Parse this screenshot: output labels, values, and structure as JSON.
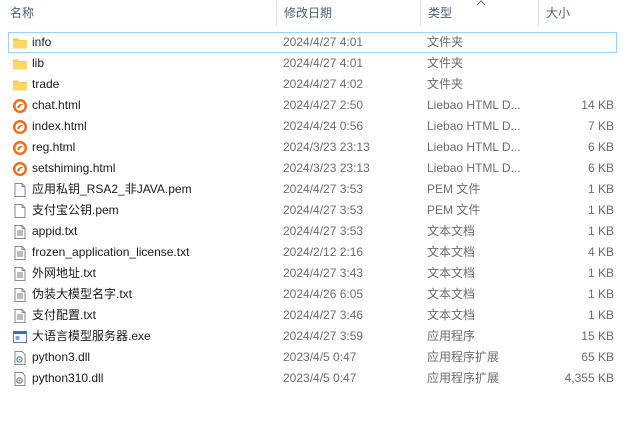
{
  "header": {
    "name": "名称",
    "date": "修改日期",
    "type": "类型",
    "size": "大小"
  },
  "files": [
    {
      "name": "info",
      "date": "2024/4/27 4:01",
      "type": "文件夹",
      "size": "",
      "icon": "folder-icon"
    },
    {
      "name": "lib",
      "date": "2024/4/27 4:01",
      "type": "文件夹",
      "size": "",
      "icon": "folder-icon"
    },
    {
      "name": "trade",
      "date": "2024/4/27 4:02",
      "type": "文件夹",
      "size": "",
      "icon": "folder-icon"
    },
    {
      "name": "chat.html",
      "date": "2024/4/27 2:50",
      "type": "Liebao HTML D...",
      "size": "14 KB",
      "icon": "liebao-html-icon"
    },
    {
      "name": "index.html",
      "date": "2024/4/24 0:56",
      "type": "Liebao HTML D...",
      "size": "7 KB",
      "icon": "liebao-html-icon"
    },
    {
      "name": "reg.html",
      "date": "2024/3/23 23:13",
      "type": "Liebao HTML D...",
      "size": "6 KB",
      "icon": "liebao-html-icon"
    },
    {
      "name": "setshiming.html",
      "date": "2024/3/23 23:13",
      "type": "Liebao HTML D...",
      "size": "6 KB",
      "icon": "liebao-html-icon"
    },
    {
      "name": "应用私钥_RSA2_非JAVA.pem",
      "date": "2024/4/27 3:53",
      "type": "PEM 文件",
      "size": "1 KB",
      "icon": "blank-file-icon"
    },
    {
      "name": "支付宝公钥.pem",
      "date": "2024/4/27 3:53",
      "type": "PEM 文件",
      "size": "1 KB",
      "icon": "blank-file-icon"
    },
    {
      "name": "appid.txt",
      "date": "2024/4/27 3:53",
      "type": "文本文档",
      "size": "1 KB",
      "icon": "text-file-icon"
    },
    {
      "name": "frozen_application_license.txt",
      "date": "2024/2/12 2:16",
      "type": "文本文档",
      "size": "4 KB",
      "icon": "text-file-icon"
    },
    {
      "name": "外网地址.txt",
      "date": "2024/4/27 3:43",
      "type": "文本文档",
      "size": "1 KB",
      "icon": "text-file-icon"
    },
    {
      "name": "伪装大模型名字.txt",
      "date": "2024/4/26 6:05",
      "type": "文本文档",
      "size": "1 KB",
      "icon": "text-file-icon"
    },
    {
      "name": "支付配置.txt",
      "date": "2024/4/27 3:46",
      "type": "文本文档",
      "size": "1 KB",
      "icon": "text-file-icon"
    },
    {
      "name": "大语言模型服务器.exe",
      "date": "2024/4/27 3:59",
      "type": "应用程序",
      "size": "15 KB",
      "icon": "exe-icon"
    },
    {
      "name": "python3.dll",
      "date": "2023/4/5 0:47",
      "type": "应用程序扩展",
      "size": "65 KB",
      "icon": "dll-icon"
    },
    {
      "name": "python310.dll",
      "date": "2023/4/5 0:47",
      "type": "应用程序扩展",
      "size": "4,355 KB",
      "icon": "dll-icon"
    }
  ],
  "colors": {
    "folder": "#f3c94f",
    "liebao": "#f06a1a",
    "focus_border": "#99d1ff",
    "header_text": "#4c607a"
  }
}
